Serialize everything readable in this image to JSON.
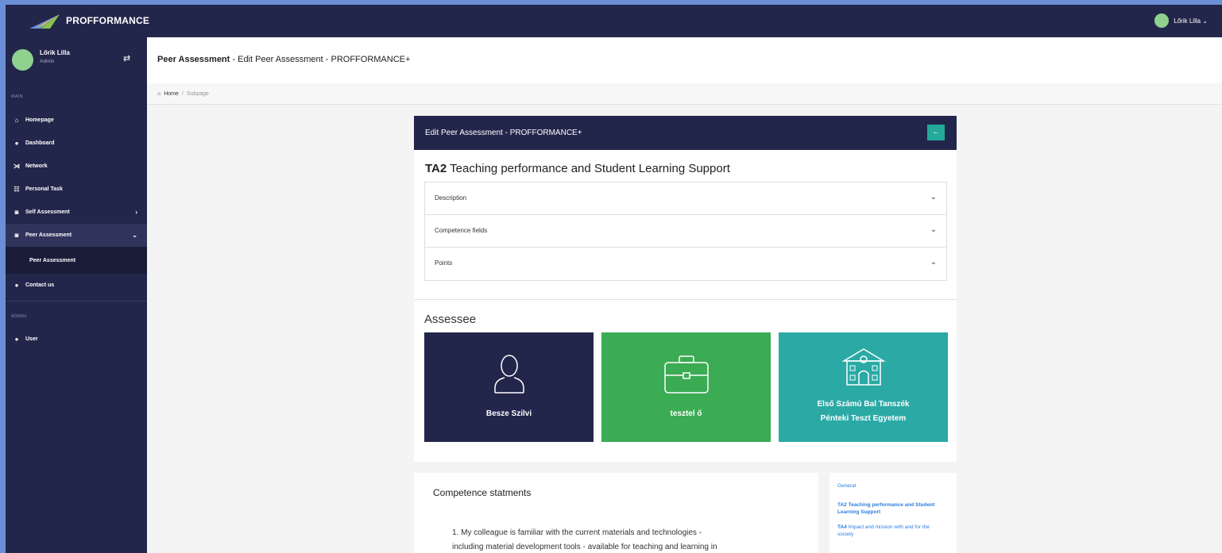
{
  "brand": {
    "name": "PROFFORMANCE"
  },
  "topbar": {
    "user_name": "Lőrik Lilla ⌄"
  },
  "sidebar": {
    "user_name": "Lőrik Lilla",
    "user_role": "Admin",
    "section_main": "MAIN",
    "section_admin": "ADMIN",
    "items": [
      {
        "label": "Homepage"
      },
      {
        "label": "Dashboard"
      },
      {
        "label": "Network"
      },
      {
        "label": "Personal Task"
      },
      {
        "label": "Self Assessment"
      },
      {
        "label": "Peer Assessment"
      },
      {
        "label": "Contact us"
      }
    ],
    "sub_item": "Peer Assessment",
    "admin_items": [
      {
        "label": "User"
      }
    ]
  },
  "header": {
    "title_bold": "Peer Assessment",
    "title_rest": " - Edit Peer Assessment - PROFFORMANCE+"
  },
  "breadcrumb": {
    "home": "Home",
    "separator": "/",
    "current": "Subpage"
  },
  "card": {
    "title": "Edit Peer Assessment - PROFFORMANCE+",
    "ta_code": "TA2",
    "ta_title": " Teaching performance and Student Learning Support",
    "accordion": [
      {
        "label": "Description"
      },
      {
        "label": "Competence fields"
      },
      {
        "label": "Points"
      }
    ],
    "assessee_heading": "Assessee",
    "tiles": [
      {
        "label": "Besze Szilvi",
        "color": "#23264b"
      },
      {
        "label": "tesztel ő",
        "color": "#3bab54"
      },
      {
        "label_line1": "Első Számú Bal Tanszék",
        "label_line2": "Pénteki Teszt Egyetem",
        "color": "#2ba9a5"
      }
    ]
  },
  "competence": {
    "heading": "Competence statments",
    "item1_line1": "1. My colleague is familiar with the current materials and technologies -",
    "item1_line2": "including material development tools - available for teaching and learning in"
  },
  "side_nav": {
    "general": "General",
    "ta2": "TA2 Teaching performance and Student Learning Support",
    "ta4_bold": "TA4",
    "ta4_rest": " Impact and mission with and for the society"
  },
  "colors": {
    "navy": "#23264b",
    "green": "#3bab54",
    "teal": "#2ba9a5",
    "link": "#2a7de1"
  }
}
